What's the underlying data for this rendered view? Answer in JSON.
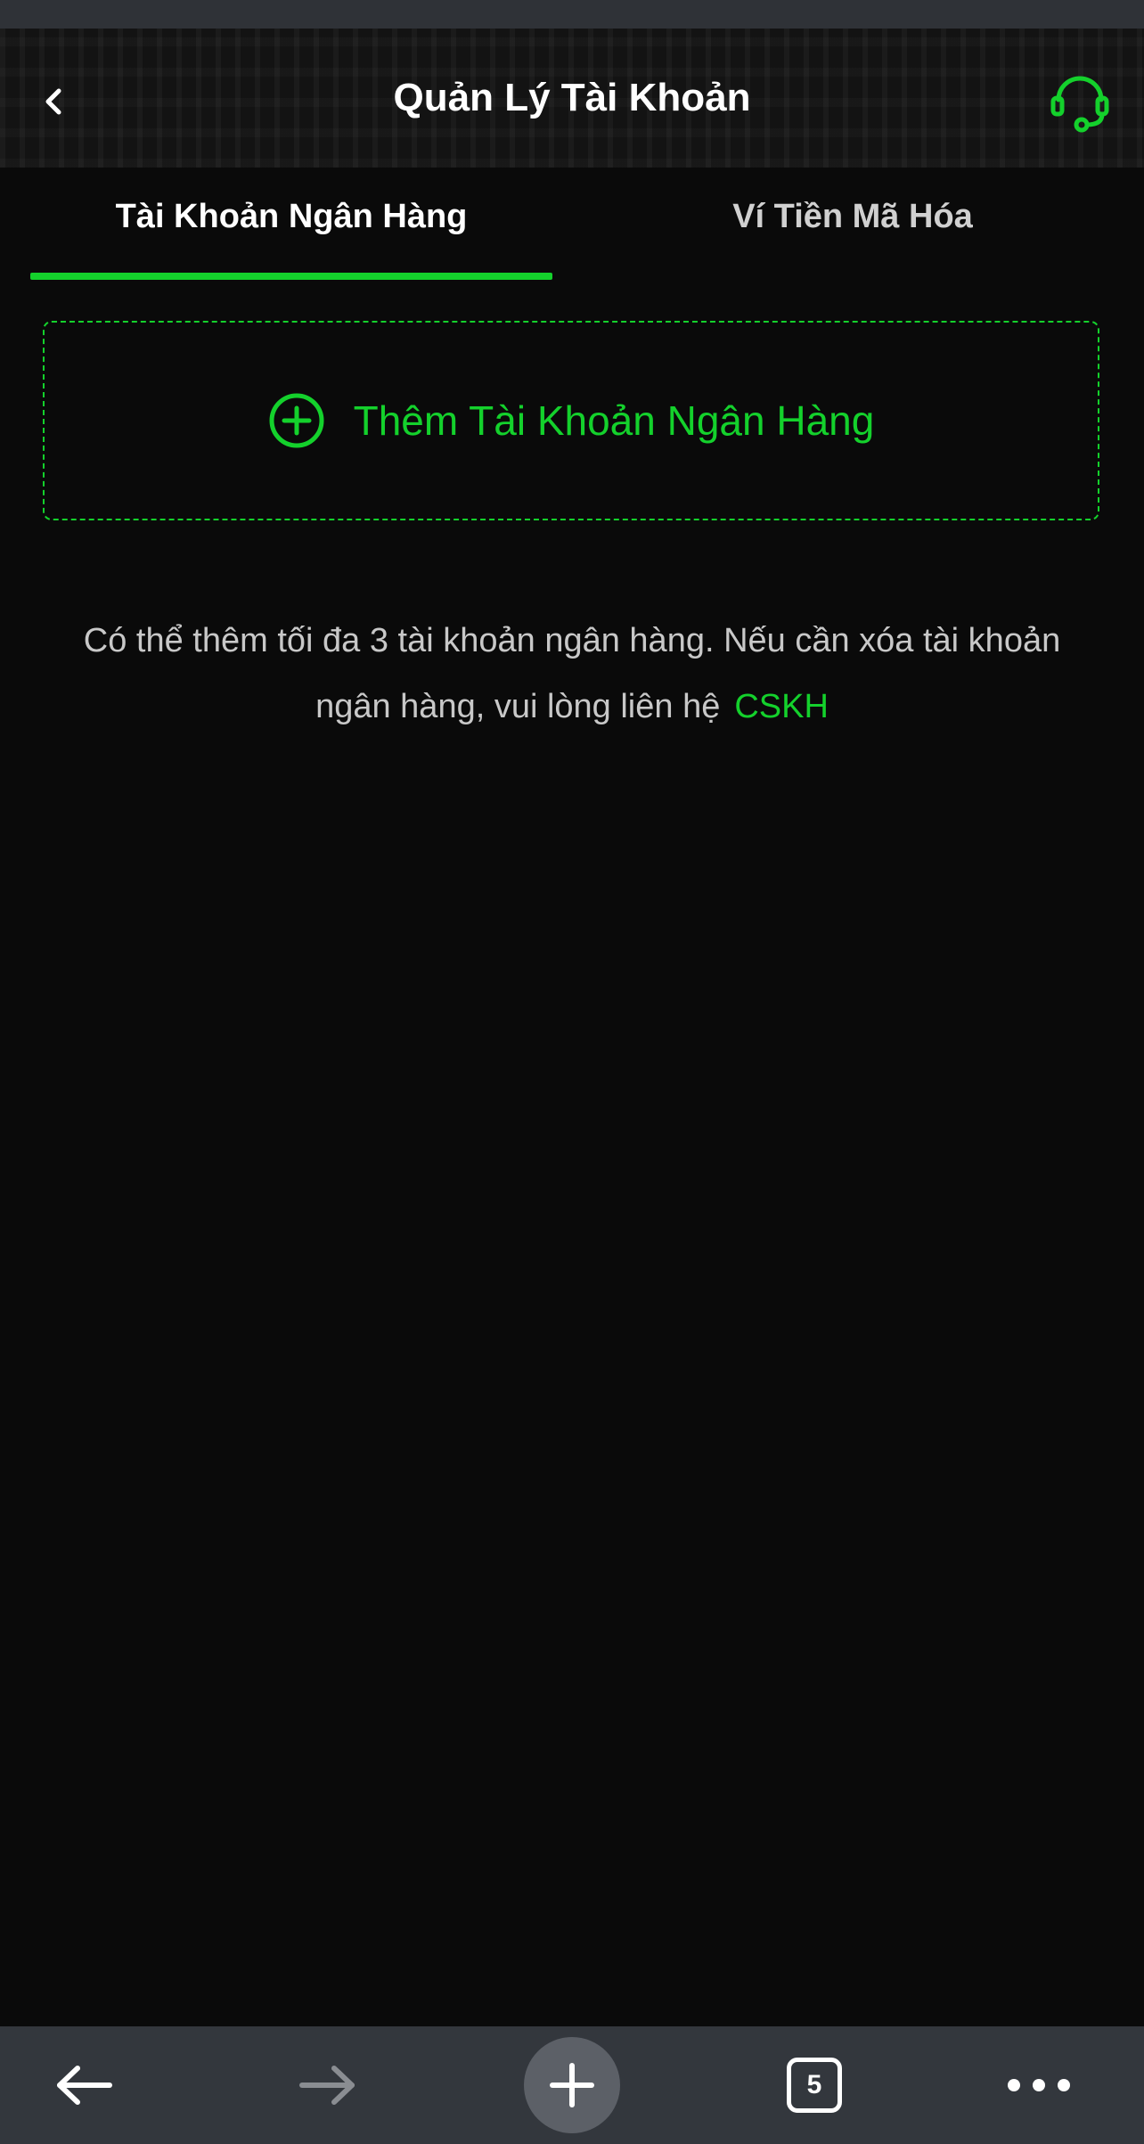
{
  "header": {
    "title": "Quản Lý Tài Khoản",
    "back_icon": "chevron-left-icon",
    "support_icon": "headset-icon"
  },
  "tabs": [
    {
      "label": "Tài Khoản Ngân Hàng",
      "active": true
    },
    {
      "label": "Ví Tiền Mã Hóa",
      "active": false
    }
  ],
  "add_bank": {
    "label": "Thêm Tài Khoản Ngân Hàng",
    "icon": "plus-circle-icon"
  },
  "note": {
    "text": "Có thể thêm tối đa 3 tài khoản ngân hàng. Nếu cần xóa tài khoản ngân hàng, vui lòng liên hệ",
    "link": "CSKH"
  },
  "browser_bar": {
    "back_icon": "arrow-left-icon",
    "forward_icon": "arrow-right-icon",
    "new_tab_icon": "plus-icon",
    "tab_count": "5",
    "menu_icon": "more-horizontal-icon"
  },
  "colors": {
    "accent": "#14d12c",
    "background": "#0a0a0a",
    "bottom_bar": "#33373d"
  }
}
